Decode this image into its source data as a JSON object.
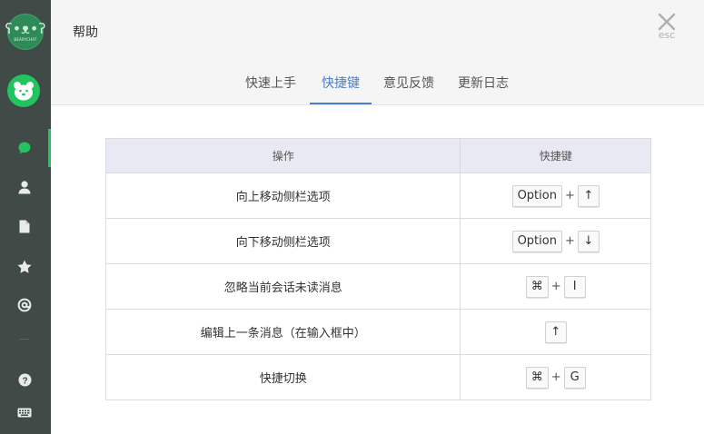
{
  "app": {
    "logo_text": "BEARYCHAT"
  },
  "header": {
    "title": "帮助",
    "close_hint": "esc"
  },
  "tabs": [
    {
      "label": "快速上手"
    },
    {
      "label": "快捷键"
    },
    {
      "label": "意见反馈"
    },
    {
      "label": "更新日志"
    }
  ],
  "active_tab": "快捷键",
  "table": {
    "columns": [
      "操作",
      "快捷键"
    ],
    "rows": [
      {
        "action": "向上移动侧栏选项",
        "keys": [
          "Option",
          "↑"
        ]
      },
      {
        "action": "向下移动侧栏选项",
        "keys": [
          "Option",
          "↓"
        ]
      },
      {
        "action": "忽略当前会话未读消息",
        "keys": [
          "⌘",
          "I"
        ]
      },
      {
        "action": "编辑上一条消息（在输入框中）",
        "keys": [
          "↑"
        ]
      },
      {
        "action": "快捷切换",
        "keys": [
          "⌘",
          "G"
        ]
      }
    ],
    "plus": "+"
  },
  "sidebar": {
    "icons": [
      "chat-icon",
      "user-icon",
      "file-icon",
      "star-icon",
      "at-icon",
      "help-icon",
      "keyboard-icon"
    ],
    "active": "chat-icon"
  },
  "colors": {
    "sidebar_bg": "#404a47",
    "accent_green": "#21c45e",
    "tab_active": "#4a7fc7",
    "table_header_bg": "#e9e9f3"
  }
}
